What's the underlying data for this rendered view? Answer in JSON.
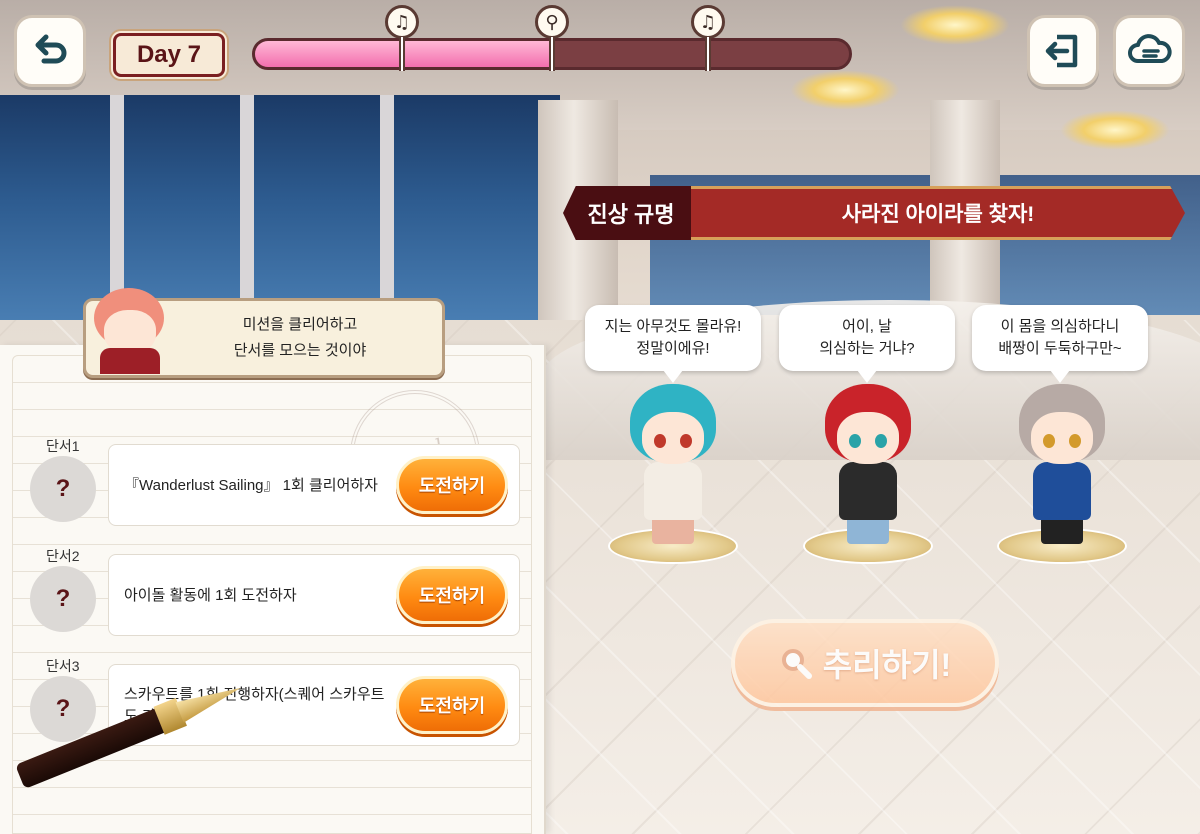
{
  "header": {
    "day_label": "Day 7",
    "progress_percent": 50,
    "milestones": [
      {
        "icon": "music-note-icon",
        "glyph": "♫",
        "position_percent": 25
      },
      {
        "icon": "magnifier-icon",
        "glyph": "⚲",
        "position_percent": 50
      },
      {
        "icon": "music-note-icon",
        "glyph": "♫",
        "position_percent": 76
      }
    ]
  },
  "mission": {
    "tag": "진상 규명",
    "title": "사라진 아이라를 찾자!"
  },
  "guide": {
    "line1": "미션을 클리어하고",
    "line2": "단서를 모으는 것이야"
  },
  "clues": [
    {
      "label": "단서1",
      "avatar": "?",
      "text": "『Wanderlust Sailing』 1회 클리어하자",
      "button": "도전하기"
    },
    {
      "label": "단서2",
      "avatar": "?",
      "text": "아이돌 활동에 1회 도전하자",
      "button": "도전하기"
    },
    {
      "label": "단서3",
      "avatar": "?",
      "text": "스카우트를 1회 진행하자(스퀘어 스카우트도 가능)",
      "button": "도전하기"
    }
  ],
  "suspects": [
    {
      "line1": "지는 아무것도 몰라유!",
      "line2": "정말이에유!",
      "hair": "#2fb3c4",
      "outfit": "#f3ede4",
      "legs": "#e9b39f",
      "eye": "#c0392b"
    },
    {
      "line1": "어이, 날",
      "line2": "의심하는 거냐?",
      "hair": "#c9232a",
      "outfit": "#2b2b2b",
      "legs": "#8fb5d6",
      "eye": "#2aa3a8"
    },
    {
      "line1": "이 몸을 의심하다니",
      "line2": "배짱이 두둑하구만~",
      "hair": "#b7aaa5",
      "outfit": "#1f4e9a",
      "legs": "#222222",
      "eye": "#d39a2c"
    }
  ],
  "deduce_button": {
    "label": "추리하기!",
    "icon": "magnifier-icon"
  },
  "stamp_text": "travel",
  "colors": {
    "accent": "#ff8b12",
    "banner": "#a42a26",
    "progress": "#f36fae"
  }
}
